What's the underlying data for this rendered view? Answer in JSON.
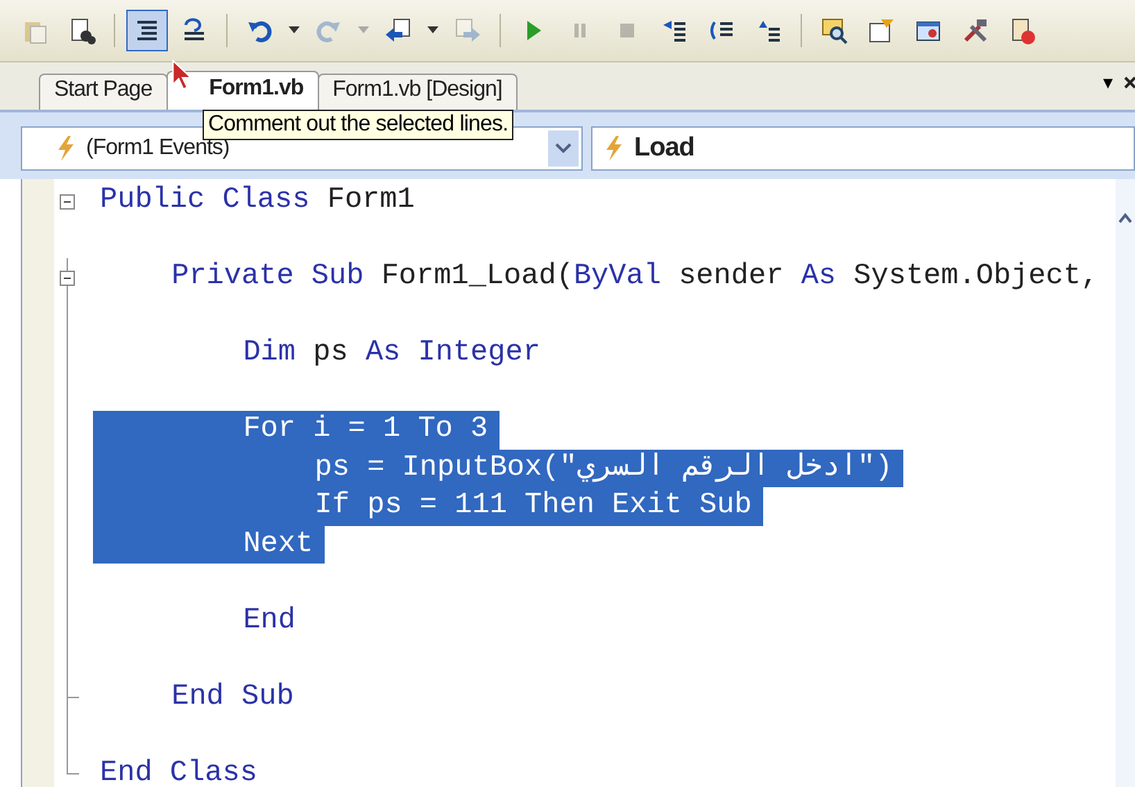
{
  "toolbar": {
    "groups": [
      [
        {
          "selected": false,
          "disabled": true
        },
        {
          "selected": false,
          "disabled": false
        }
      ],
      [
        {
          "selected": true,
          "disabled": false
        },
        {
          "selected": false,
          "disabled": false
        }
      ],
      [
        {
          "selected": false,
          "disabled": false,
          "dropdown": true
        },
        {
          "selected": false,
          "disabled": true,
          "dropdown": true
        },
        {
          "selected": false,
          "disabled": false,
          "dropdown": true
        },
        {
          "selected": false,
          "disabled": true
        }
      ],
      [
        {
          "selected": false,
          "disabled": false
        },
        {
          "selected": false,
          "disabled": true
        },
        {
          "selected": false,
          "disabled": true
        },
        {
          "selected": false,
          "disabled": false
        },
        {
          "selected": false,
          "disabled": false
        },
        {
          "selected": false,
          "disabled": false
        }
      ],
      [
        {
          "selected": false,
          "disabled": false
        },
        {
          "selected": false,
          "disabled": false
        },
        {
          "selected": false,
          "disabled": false
        },
        {
          "selected": false,
          "disabled": false
        },
        {
          "selected": false,
          "disabled": false
        }
      ]
    ]
  },
  "tabs": [
    {
      "label": "Start Page",
      "selected": false
    },
    {
      "label": "Form1.vb",
      "selected": true
    },
    {
      "label": "Form1.vb [Design]",
      "selected": false
    }
  ],
  "tab_menu": "▾",
  "tooltip": "Comment out the selected lines.",
  "class_dropdown": {
    "value": "(Form1 Events)"
  },
  "method_dropdown": {
    "value": "Load"
  },
  "code_lines": [
    {
      "selected": false,
      "collapsible": true,
      "blank_after": true,
      "tokens": [
        {
          "kind": "keyword",
          "text": "Public Class"
        },
        {
          "kind": "plain",
          "text": "Form1"
        }
      ],
      "children": [
        {
          "selected": false,
          "collapsible": true,
          "blank_after": true,
          "tokens": [
            {
              "kind": "keyword",
              "text": "Private Sub"
            },
            {
              "kind": "plain",
              "text": "Form1_Load("
            },
            {
              "kind": "keyword",
              "text": "ByVal",
              "glued": true
            },
            {
              "kind": "plain",
              "text": "sender"
            },
            {
              "kind": "keyword",
              "text": "As"
            },
            {
              "kind": "plain",
              "text": "System.Object,"
            }
          ],
          "children": [
            {
              "selected": false,
              "blank_after": true,
              "tokens": [
                {
                  "kind": "keyword",
                  "text": "Dim"
                },
                {
                  "kind": "plain",
                  "text": "ps"
                },
                {
                  "kind": "keyword",
                  "text": "As Integer"
                }
              ]
            },
            {
              "selected": true,
              "blank_after": false,
              "text": "For i = 1 To 3",
              "children": [
                {
                  "selected": true,
                  "blank_after": false,
                  "text": "ps = InputBox(\"ادخل الرقم السري\")"
                },
                {
                  "selected": true,
                  "blank_after": false,
                  "text": "If ps = 111 Then Exit Sub"
                }
              ]
            },
            {
              "selected": true,
              "blank_after": true,
              "text": "Next"
            },
            {
              "selected": false,
              "blank_after": true,
              "tokens": [
                {
                  "kind": "keyword",
                  "text": "End"
                }
              ]
            }
          ]
        },
        {
          "selected": false,
          "block_end": true,
          "blank_after": true,
          "tokens": [
            {
              "kind": "keyword",
              "text": "End Sub"
            }
          ]
        }
      ]
    },
    {
      "selected": false,
      "block_end": true,
      "blank_after": false,
      "tokens": [
        {
          "kind": "keyword",
          "text": "End Class"
        }
      ]
    }
  ]
}
